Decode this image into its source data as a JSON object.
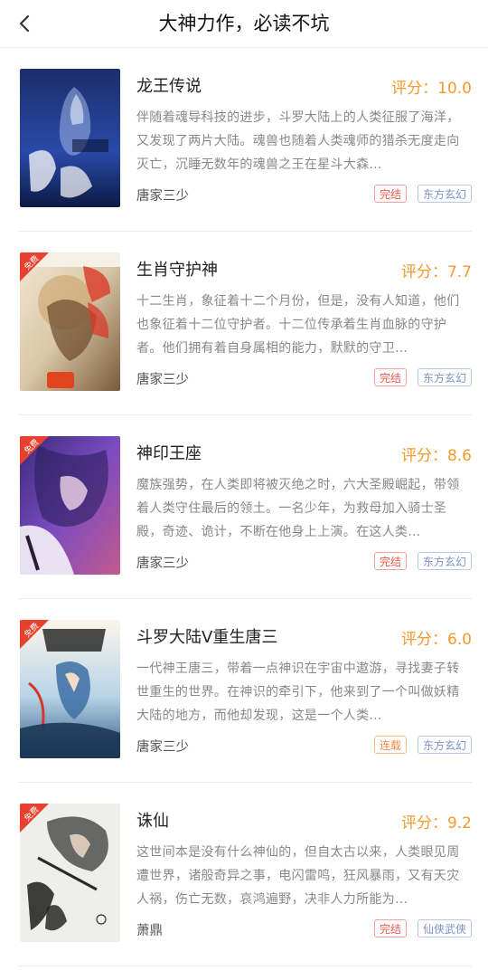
{
  "header": {
    "title": "大神力作，必读不坑"
  },
  "badge_label": "免费",
  "books": [
    {
      "title": "龙王传说",
      "score": "评分：10.0",
      "description": "伴随着魂导科技的进步，斗罗大陆上的人类征服了海洋，又发现了两片大陆。魂兽也随着人类魂师的猎杀无度走向灭亡，沉睡无数年的魂兽之王在星斗大森…",
      "author": "唐家三少",
      "status": "完结",
      "genre": "东方玄幻"
    },
    {
      "title": "生肖守护神",
      "score": "评分：7.7",
      "description": "十二生肖，象征着十二个月份，但是，没有人知道，他们也象征着十二位守护者。十二位传承着生肖血脉的守护者。他们拥有着自身属相的能力，默默的守卫…",
      "author": "唐家三少",
      "status": "完结",
      "genre": "东方玄幻"
    },
    {
      "title": "神印王座",
      "score": "评分：8.6",
      "description": "魔族强势，在人类即将被灭绝之时，六大圣殿崛起，带领着人类守住最后的领土。一名少年，为救母加入骑士圣殿，奇迹、诡计，不断在他身上上演。在这人类…",
      "author": "唐家三少",
      "status": "完结",
      "genre": "东方玄幻"
    },
    {
      "title": "斗罗大陆V重生唐三",
      "score": "评分：6.0",
      "description": "一代神王唐三，带着一点神识在宇宙中遨游，寻找妻子转世重生的世界。在神识的牵引下，他来到了一个叫做妖精大陆的地方，而他却发现，这是一个人类…",
      "author": "唐家三少",
      "status": "连载",
      "genre": "东方玄幻"
    },
    {
      "title": "诛仙",
      "score": "评分：9.2",
      "description": "这世间本是没有什么神仙的，但自太古以来，人类眼见周遭世界，诸般奇异之事，电闪雷鸣，狂风暴雨，又有天灾人祸，伤亡无数，哀鸿遍野，决非人力所能为…",
      "author": "萧鼎",
      "status": "完结",
      "genre": "仙侠武侠"
    }
  ],
  "colors": {
    "score": "#f39a2c",
    "status_finished": "#e85b4d",
    "status_serial": "#f08a39",
    "genre": "#7b93c9",
    "badge": "#e8412f"
  }
}
